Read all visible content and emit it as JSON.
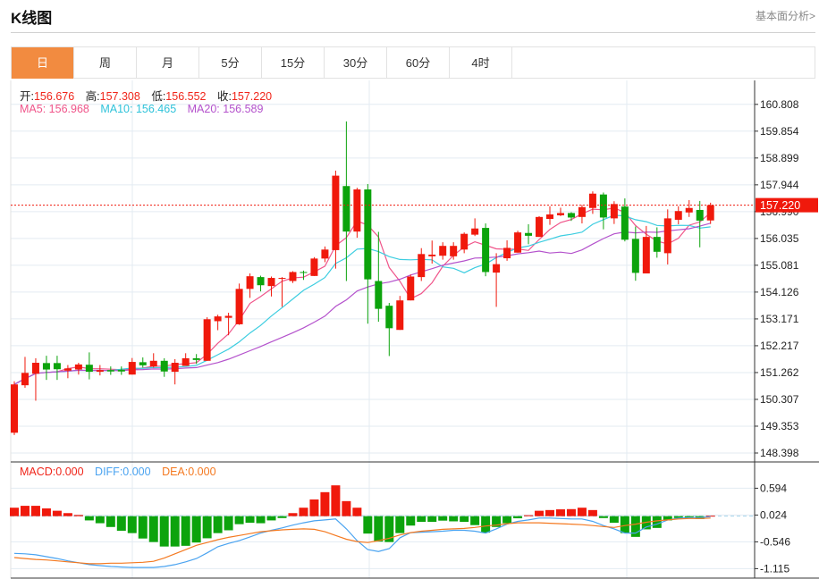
{
  "header": {
    "title": "K线图",
    "link": "基本面分析>"
  },
  "tabs": [
    {
      "label": "日",
      "active": true
    },
    {
      "label": "周"
    },
    {
      "label": "月"
    },
    {
      "label": "5分"
    },
    {
      "label": "15分"
    },
    {
      "label": "30分"
    },
    {
      "label": "60分"
    },
    {
      "label": "4时"
    }
  ],
  "ohlc_info": {
    "open_label": "开:",
    "open": "156.676",
    "high_label": "高:",
    "high": "157.308",
    "low_label": "低:",
    "low": "156.552",
    "close_label": "收:",
    "close": "157.220"
  },
  "ma_info": {
    "ma5_label": "MA5:",
    "ma5": "156.968",
    "ma10_label": "MA10:",
    "ma10": "156.465",
    "ma20_label": "MA20:",
    "ma20": "156.589"
  },
  "macd_info": {
    "macd_label": "MACD:",
    "macd": "0.000",
    "diff_label": "DIFF:",
    "diff": "0.000",
    "dea_label": "DEA:",
    "dea": "0.000"
  },
  "colors": {
    "up": "#f0190c",
    "down": "#0ca30c",
    "ma5": "#f0558a",
    "ma10": "#3ccde0",
    "ma20": "#b452cc",
    "diff": "#4aa3f0",
    "dea": "#f47920",
    "accent": "#f28b40"
  },
  "chart_data": {
    "type": "candlestick",
    "price_panel": {
      "ylim": [
        148.398,
        160.808
      ],
      "yticks": [
        "160.808",
        "159.854",
        "158.899",
        "157.944",
        "156.990",
        "156.035",
        "155.081",
        "154.126",
        "153.171",
        "152.217",
        "151.262",
        "150.307",
        "149.353",
        "148.398"
      ],
      "last_price": "157.220",
      "candles": [
        [
          149.12,
          150.95,
          149.04,
          150.84
        ],
        [
          150.81,
          151.82,
          150.72,
          151.25
        ],
        [
          151.22,
          151.77,
          150.26,
          151.61
        ],
        [
          151.6,
          151.86,
          151.0,
          151.37
        ],
        [
          151.6,
          151.86,
          151.0,
          151.38
        ],
        [
          151.33,
          151.53,
          151.06,
          151.41
        ],
        [
          151.37,
          151.61,
          151.19,
          151.55
        ],
        [
          151.54,
          151.98,
          151.02,
          151.29
        ],
        [
          151.29,
          151.53,
          151.16,
          151.35
        ],
        [
          151.35,
          151.48,
          151.18,
          151.3
        ],
        [
          151.36,
          151.48,
          151.18,
          151.3
        ],
        [
          151.19,
          151.78,
          151.19,
          151.64
        ],
        [
          151.63,
          151.8,
          151.44,
          151.52
        ],
        [
          151.48,
          151.95,
          151.44,
          151.68
        ],
        [
          151.68,
          151.77,
          151.11,
          151.3
        ],
        [
          151.29,
          151.74,
          150.84,
          151.61
        ],
        [
          151.5,
          151.95,
          151.5,
          151.77
        ],
        [
          151.77,
          151.92,
          151.57,
          151.71
        ],
        [
          151.68,
          153.23,
          151.68,
          153.16
        ],
        [
          153.09,
          153.32,
          152.77,
          153.26
        ],
        [
          153.21,
          153.39,
          152.59,
          153.28
        ],
        [
          152.98,
          154.43,
          152.96,
          154.24
        ],
        [
          154.24,
          154.79,
          153.92,
          154.69
        ],
        [
          154.66,
          154.71,
          154.15,
          154.37
        ],
        [
          154.34,
          154.68,
          153.97,
          154.63
        ],
        [
          154.6,
          154.66,
          153.6,
          154.63
        ],
        [
          154.52,
          154.87,
          154.45,
          154.84
        ],
        [
          154.84,
          154.89,
          154.56,
          154.81
        ],
        [
          154.7,
          155.37,
          154.7,
          155.32
        ],
        [
          155.32,
          155.75,
          155.19,
          155.64
        ],
        [
          155.62,
          158.45,
          154.96,
          158.27
        ],
        [
          157.9,
          160.2,
          154.52,
          156.28
        ],
        [
          156.28,
          157.84,
          156.06,
          157.78
        ],
        [
          157.78,
          157.97,
          153.0,
          154.58
        ],
        [
          154.52,
          156.27,
          153.07,
          153.53
        ],
        [
          153.64,
          153.74,
          151.85,
          152.84
        ],
        [
          152.78,
          153.99,
          152.78,
          153.83
        ],
        [
          153.83,
          154.75,
          153.83,
          154.68
        ],
        [
          154.66,
          155.69,
          154.52,
          155.48
        ],
        [
          155.4,
          155.96,
          155.14,
          155.46
        ],
        [
          155.42,
          155.9,
          155.28,
          155.77
        ],
        [
          155.4,
          155.9,
          155.28,
          155.77
        ],
        [
          155.64,
          156.25,
          155.51,
          156.2
        ],
        [
          156.17,
          156.75,
          156.12,
          156.39
        ],
        [
          156.41,
          156.57,
          154.69,
          154.84
        ],
        [
          154.82,
          155.51,
          153.6,
          155.12
        ],
        [
          155.33,
          155.97,
          155.24,
          155.7
        ],
        [
          155.53,
          156.31,
          155.53,
          156.25
        ],
        [
          156.23,
          156.54,
          155.83,
          156.13
        ],
        [
          156.09,
          156.83,
          156.09,
          156.8
        ],
        [
          156.73,
          157.18,
          156.52,
          156.89
        ],
        [
          156.86,
          157.13,
          156.83,
          156.94
        ],
        [
          156.94,
          156.97,
          156.66,
          156.78
        ],
        [
          156.8,
          157.23,
          156.57,
          157.15
        ],
        [
          157.12,
          157.71,
          156.91,
          157.63
        ],
        [
          157.6,
          157.67,
          156.36,
          156.78
        ],
        [
          156.75,
          157.36,
          156.55,
          157.26
        ],
        [
          157.17,
          157.46,
          155.93,
          155.99
        ],
        [
          156.02,
          156.46,
          154.53,
          154.81
        ],
        [
          154.79,
          156.48,
          154.79,
          156.09
        ],
        [
          156.09,
          156.43,
          155.35,
          155.56
        ],
        [
          155.51,
          157.07,
          155.11,
          156.75
        ],
        [
          156.7,
          157.18,
          156.54,
          157.01
        ],
        [
          156.96,
          157.4,
          156.8,
          157.12
        ],
        [
          157.05,
          157.37,
          155.72,
          156.67
        ],
        [
          156.676,
          157.308,
          156.552,
          157.22
        ]
      ],
      "ma_periods": [
        5,
        10,
        20
      ]
    },
    "macd_panel": {
      "ylim": [
        -1.115,
        0.594
      ],
      "yticks": [
        "0.594",
        "0.024",
        "-0.546",
        "-1.115"
      ],
      "macd": [
        0.18,
        0.22,
        0.22,
        0.165,
        0.115,
        0.065,
        0.025,
        -0.09,
        -0.15,
        -0.23,
        -0.31,
        -0.36,
        -0.475,
        -0.55,
        -0.645,
        -0.645,
        -0.63,
        -0.56,
        -0.47,
        -0.36,
        -0.3,
        -0.17,
        -0.14,
        -0.15,
        -0.09,
        -0.04,
        0.065,
        0.18,
        0.355,
        0.51,
        0.655,
        0.32,
        0.18,
        -0.37,
        -0.54,
        -0.55,
        -0.36,
        -0.2,
        -0.12,
        -0.12,
        -0.095,
        -0.11,
        -0.12,
        -0.19,
        -0.35,
        -0.23,
        -0.15,
        -0.045,
        0.02,
        0.115,
        0.13,
        0.145,
        0.15,
        0.18,
        0.13,
        -0.04,
        -0.14,
        -0.36,
        -0.44,
        -0.28,
        -0.25,
        -0.09,
        -0.04,
        -0.03,
        -0.06,
        0.01
      ],
      "diff": [
        -0.79,
        -0.8,
        -0.82,
        -0.86,
        -0.9,
        -0.95,
        -0.99,
        -1.03,
        -1.05,
        -1.07,
        -1.08,
        -1.09,
        -1.09,
        -1.09,
        -1.07,
        -1.03,
        -0.97,
        -0.9,
        -0.78,
        -0.65,
        -0.58,
        -0.52,
        -0.44,
        -0.36,
        -0.3,
        -0.25,
        -0.19,
        -0.14,
        -0.1,
        -0.08,
        -0.06,
        -0.27,
        -0.52,
        -0.71,
        -0.75,
        -0.69,
        -0.46,
        -0.35,
        -0.34,
        -0.33,
        -0.32,
        -0.3,
        -0.3,
        -0.32,
        -0.36,
        -0.27,
        -0.17,
        -0.11,
        -0.08,
        -0.04,
        -0.04,
        -0.05,
        -0.06,
        -0.06,
        -0.11,
        -0.2,
        -0.27,
        -0.36,
        -0.36,
        -0.23,
        -0.17,
        -0.08,
        -0.04,
        -0.03,
        -0.03,
        -0.01
      ],
      "dea": [
        -0.88,
        -0.9,
        -0.92,
        -0.93,
        -0.95,
        -0.97,
        -0.99,
        -1.01,
        -1.01,
        -1.0,
        -1.0,
        -0.99,
        -0.98,
        -0.96,
        -0.89,
        -0.8,
        -0.71,
        -0.62,
        -0.56,
        -0.5,
        -0.45,
        -0.41,
        -0.37,
        -0.33,
        -0.31,
        -0.29,
        -0.28,
        -0.27,
        -0.28,
        -0.33,
        -0.41,
        -0.49,
        -0.54,
        -0.56,
        -0.52,
        -0.47,
        -0.4,
        -0.35,
        -0.32,
        -0.3,
        -0.28,
        -0.27,
        -0.26,
        -0.24,
        -0.21,
        -0.19,
        -0.16,
        -0.14,
        -0.14,
        -0.14,
        -0.15,
        -0.16,
        -0.17,
        -0.18,
        -0.2,
        -0.22,
        -0.24,
        -0.2,
        -0.17,
        -0.13,
        -0.1,
        -0.08,
        -0.06,
        -0.05,
        -0.05,
        -0.04
      ]
    }
  }
}
